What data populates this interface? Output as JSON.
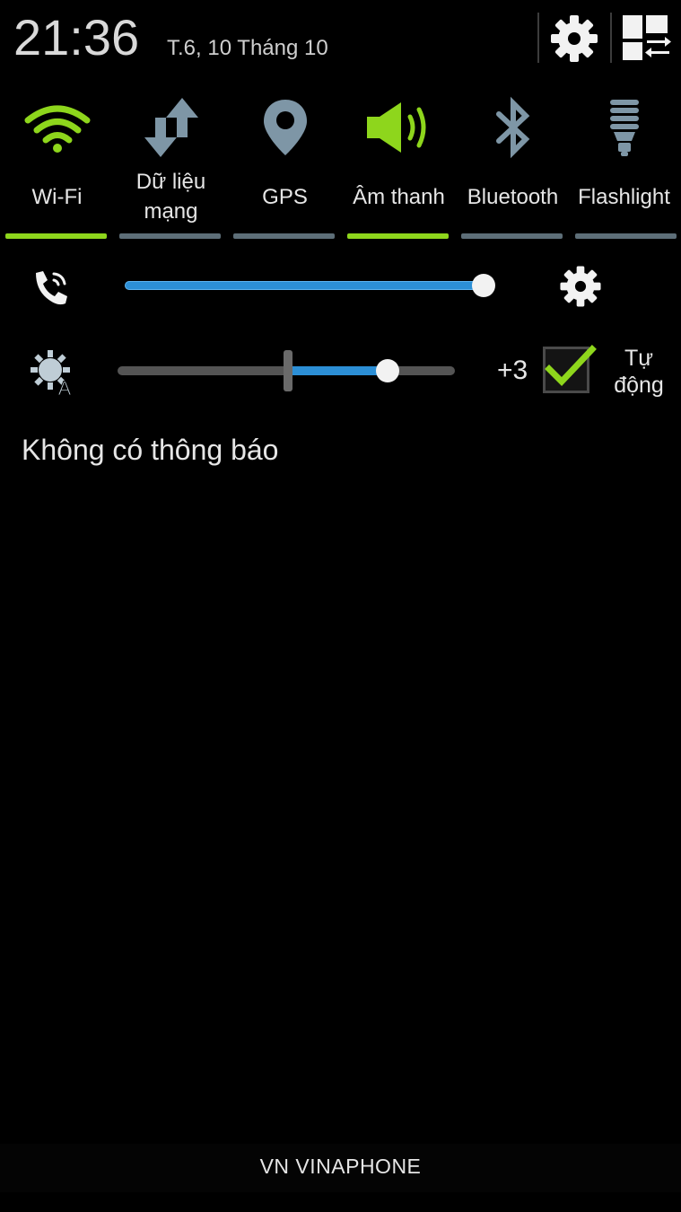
{
  "status": {
    "time": "21:36",
    "date": "T.6, 10 Tháng 10"
  },
  "toggles": [
    {
      "label": "Wi-Fi",
      "icon": "wifi-icon",
      "on": true
    },
    {
      "label": "Dữ liệu\nmạng",
      "line1": "Dữ liệu",
      "line2": "mạng",
      "icon": "mobile-data-icon",
      "on": false
    },
    {
      "label": "GPS",
      "icon": "location-pin-icon",
      "on": false
    },
    {
      "label": "Âm thanh",
      "icon": "volume-icon",
      "on": true
    },
    {
      "label": "Bluetooth",
      "icon": "bluetooth-icon",
      "on": false
    },
    {
      "label": "Flashlight",
      "icon": "flashlight-icon",
      "on": false
    }
  ],
  "volume": {
    "level": 1.0,
    "icon": "call-volume-icon"
  },
  "brightness": {
    "level": 0.8,
    "value_label": "+3",
    "auto_checked": true,
    "auto_line1": "Tự",
    "auto_line2": "động",
    "icon": "auto-brightness-icon"
  },
  "notifications": {
    "empty_text": "Không có thông báo"
  },
  "carrier": {
    "name": "VN VINAPHONE"
  },
  "colors": {
    "accent_on": "#8ed61c",
    "accent_off": "#5d6e78",
    "slider_fill": "#2c8fd6",
    "icon_gray": "#7e96a6"
  }
}
